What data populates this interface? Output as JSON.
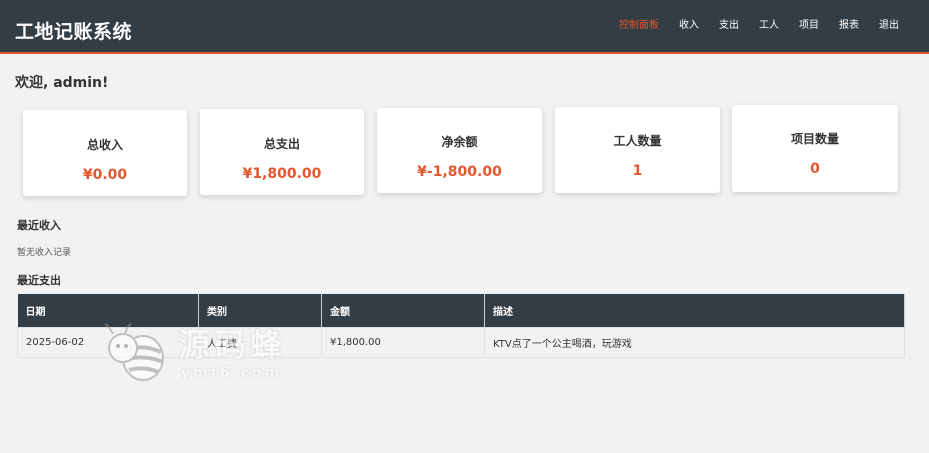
{
  "app": {
    "title": "工地记账系统"
  },
  "nav": {
    "items": [
      {
        "label": "控制面板",
        "active": true
      },
      {
        "label": "收入",
        "active": false
      },
      {
        "label": "支出",
        "active": false
      },
      {
        "label": "工人",
        "active": false
      },
      {
        "label": "项目",
        "active": false
      },
      {
        "label": "报表",
        "active": false
      },
      {
        "label": "退出",
        "active": false
      }
    ]
  },
  "welcome": "欢迎, admin!",
  "stats": [
    {
      "title": "总收入",
      "value": "¥0.00"
    },
    {
      "title": "总支出",
      "value": "¥1,800.00"
    },
    {
      "title": "净余额",
      "value": "¥-1,800.00"
    },
    {
      "title": "工人数量",
      "value": "1"
    },
    {
      "title": "项目数量",
      "value": "0"
    }
  ],
  "recent_income": {
    "title": "最近收入",
    "empty": "暂无收入记录"
  },
  "recent_expense": {
    "title": "最近支出",
    "headers": [
      "日期",
      "类别",
      "金额",
      "描述"
    ],
    "rows": [
      [
        "2025-06-02",
        "人工费",
        "¥1,800.00",
        "KTV点了一个公主喝酒，玩游戏"
      ]
    ]
  },
  "watermark": {
    "text": "源码蜂",
    "sub": "ymf6.com"
  },
  "colors": {
    "header_bg": "#333d45",
    "accent": "#e4572e",
    "page_bg": "#f2f2f2"
  }
}
